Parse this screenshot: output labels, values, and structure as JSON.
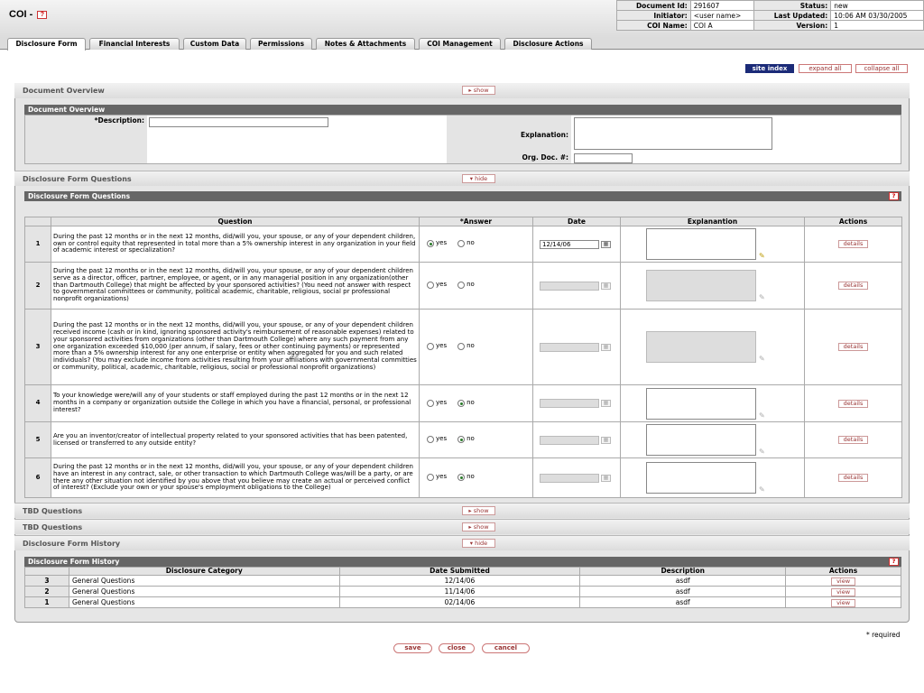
{
  "header": {
    "title": "COI -",
    "help_icon": "?",
    "doc_id_label": "Document Id:",
    "doc_id": "291607",
    "status_label": "Status:",
    "status": "new",
    "initiator_label": "Initiator:",
    "initiator": "<user name>",
    "last_updated_label": "Last Updated:",
    "last_updated": "10:06 AM 03/30/2005",
    "coi_name_label": "COI Name:",
    "coi_name": "COI A",
    "version_label": "Version:",
    "version": "1"
  },
  "tabs": [
    {
      "label": "Disclosure Form"
    },
    {
      "label": "Financial Interests"
    },
    {
      "label": "Custom Data"
    },
    {
      "label": "Permissions"
    },
    {
      "label": "Notes & Attachments"
    },
    {
      "label": "COI Management"
    },
    {
      "label": "Disclosure Actions"
    }
  ],
  "top_buttons": {
    "site_index": "site index",
    "expand_all": "expand all",
    "collapse_all": "collapse all"
  },
  "toggles": {
    "show": "▸ show",
    "hide": "▾ hide"
  },
  "document_overview": {
    "title": "Document Overview",
    "sub_title": "Document Overview",
    "description_label": "*Description:",
    "description_value": "",
    "explanation_label": "Explanation:",
    "explanation_value": "",
    "org_doc_label": "Org. Doc. #:",
    "org_doc_value": ""
  },
  "questions_section": {
    "title": "Disclosure Form Questions",
    "sub_title": "Disclosure Form Questions",
    "help_icon": "?",
    "columns": [
      "Question",
      "*Answer",
      "Date",
      "Explanantion",
      "Actions"
    ],
    "yes_label": "yes",
    "no_label": "no",
    "details_label": "details",
    "rows": [
      {
        "num": "1",
        "text": "During the past 12 months or in the next 12 months, did/will you, your spouse, or any of your dependent children, own or control equity that represented in total more than a 5% ownership interest in any organization in your field of academic interest or specialization?",
        "answer": "yes",
        "date": "12/14/06"
      },
      {
        "num": "2",
        "text": "During the past 12 months or in the next 12 months, did/will you, your spouse, or any of your dependent children serve as a director, officer, partner, employee, or agent, or in any managerial position in any organization(other than Dartmouth College) that might be affected by your sponsored activities? (You need not answer with respect to governmental committees or community, political academic, charitable, religious, social pr professional nonprofit organizations)",
        "answer": "",
        "date": ""
      },
      {
        "num": "3",
        "text": "During the past 12 months or in the next 12 months, did/will you, your spouse, or any of your dependent children received income (cash or in kind, ignoring sponsored activity's reimbursement of reasonable expenses) related to your sponsored activities from organizations (other than Dartmouth College) where any such payment from any one organization exceeded $10,000 (per annum, if salary, fees or other continuing payments) or represented more than a 5% ownership interest for any one enterprise or entity when aggregated for you and such related individuals? (You may exclude income from activities resulting from your affiliations with governmental committies or community, political, academic, charitable, religious, social or professional nonprofit organizations)",
        "answer": "",
        "date": ""
      },
      {
        "num": "4",
        "text": "To your knowledge were/will any of your students or staff employed during the past 12 months or in the next 12 months in a company or organization outside the College in which you have a financial, personal, or professional interest?",
        "answer": "no",
        "date": ""
      },
      {
        "num": "5",
        "text": "Are you an inventor/creator of intellectual property related to your sponsored activities that has been patented, licensed or transferred to any outside entity?",
        "answer": "no",
        "date": ""
      },
      {
        "num": "6",
        "text": "During the past 12 months or in the next 12 months, did/will you, your spouse, or any of your dependent children have an interest in any contract, sale, or other transaction to which Dartmouth College was/will be a party, or are there any other situation not identified by you above that you believe may create an actual or perceived conflict of interest? (Exclude your own or your spouse's employment obligations to the College)",
        "answer": "no",
        "date": ""
      }
    ]
  },
  "tbd_sections": [
    {
      "title": "TBD Questions"
    },
    {
      "title": "TBD Questions"
    }
  ],
  "history_section": {
    "title": "Disclosure Form History",
    "sub_title": "Disclosure Form History",
    "help_icon": "?",
    "columns": [
      "Disclosure Category",
      "Date Submitted",
      "Description",
      "Actions"
    ],
    "view_label": "view",
    "rows": [
      {
        "num": "3",
        "category": "General Questions",
        "date": "12/14/06",
        "description": "asdf"
      },
      {
        "num": "2",
        "category": "General Questions",
        "date": "11/14/06",
        "description": "asdf"
      },
      {
        "num": "1",
        "category": "General Questions",
        "date": "02/14/06",
        "description": "asdf"
      }
    ]
  },
  "footer": {
    "required_note": "* required",
    "save": "save",
    "close": "close",
    "cancel": "cancel"
  }
}
